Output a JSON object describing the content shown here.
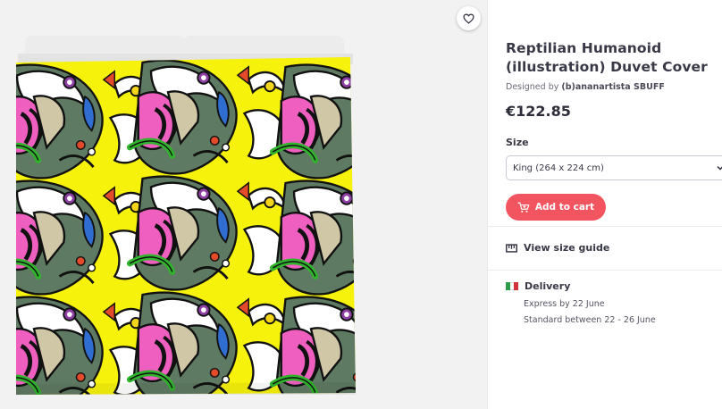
{
  "product": {
    "title": "Reptilian Humanoid (illustration) Duvet Cover",
    "designed_by_prefix": "Designed by",
    "designer": "(b)ananartista SBUFF",
    "price": "€122.85"
  },
  "size": {
    "label": "Size",
    "selected": "King (264 x 224 cm)"
  },
  "actions": {
    "add_to_cart": "Add to cart",
    "size_guide": "View size guide"
  },
  "delivery": {
    "label": "Delivery",
    "express": "Express by 22 June",
    "standard": "Standard between 22 - 26 June"
  },
  "colors": {
    "accent": "#f2555f",
    "pattern_background": "#f6f20c",
    "flag": [
      "#2e9b46",
      "#ffffff",
      "#d3323c"
    ]
  },
  "icons": {
    "favorite": "heart-icon",
    "cart": "cart-icon",
    "ruler": "ruler-icon",
    "chevron": "chevron-down-icon"
  }
}
